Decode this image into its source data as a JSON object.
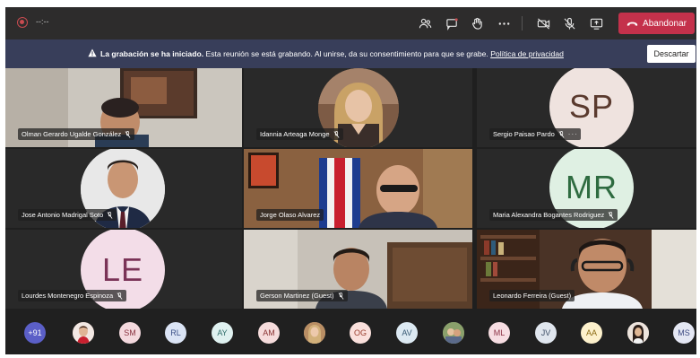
{
  "topbar": {
    "timer": "--:--",
    "icons": [
      "people-icon",
      "chat-icon",
      "raise-hand-icon",
      "more-icon",
      "camera-off-icon",
      "mic-off-icon",
      "share-icon"
    ],
    "leave_label": "Abandonar",
    "leave_color": "#c4314b"
  },
  "banner": {
    "title": "La grabación se ha iniciado.",
    "message": "Esta reunión se está grabando. Al unirse, da su consentimiento para que se grabe.",
    "link": "Política de privacidad",
    "dismiss_label": "Descartar",
    "color": "#383e5a"
  },
  "tiles": [
    {
      "name": "Olman Gerardo Ugalde González",
      "type": "video"
    },
    {
      "name": "Idannia Arteaga Monge",
      "type": "photo"
    },
    {
      "name": "Sergio Paisao Pardo",
      "type": "initials",
      "initials": "SP",
      "bg": "#efe3df",
      "fg": "#5a3a2e",
      "more": "···"
    },
    {
      "name": "Jose Antonio Madrigal Soto",
      "type": "photo"
    },
    {
      "name": "Jorge Olaso Alvarez",
      "type": "video"
    },
    {
      "name": "Maria Alexandra Bogantes Rodriguez",
      "type": "initials",
      "initials": "MR",
      "bg": "#dff0e3",
      "fg": "#2e6b40"
    },
    {
      "name": "Lourdes Montenegro Espinoza",
      "type": "initials",
      "initials": "LE",
      "bg": "#f3dde8",
      "fg": "#7a3357"
    },
    {
      "name": "Gerson Martinez (Guest)",
      "type": "video"
    },
    {
      "name": "Leonardo Ferreira (Guest)",
      "type": "video"
    }
  ],
  "roster": [
    {
      "label": "+91",
      "bg": "#5b5fc7",
      "fg": "#ffffff"
    },
    {
      "label": "",
      "photo": true,
      "bg": "#c98e7a"
    },
    {
      "label": "SM",
      "bg": "#f4d9de",
      "fg": "#8a3340"
    },
    {
      "label": "RL",
      "bg": "#dbe4f5",
      "fg": "#3a4f86"
    },
    {
      "label": "AY",
      "bg": "#dff1f0",
      "fg": "#2f6d6a"
    },
    {
      "label": "AM",
      "bg": "#f6dcdc",
      "fg": "#8a3434"
    },
    {
      "label": "",
      "photo": true,
      "bg": "#d7b08c"
    },
    {
      "label": "OG",
      "bg": "#fae0dc",
      "fg": "#9a3f2f"
    },
    {
      "label": "AV",
      "bg": "#dce9f2",
      "fg": "#385a75"
    },
    {
      "label": "",
      "photo": true,
      "bg": "#9fae83"
    },
    {
      "label": "ML",
      "bg": "#f7dde2",
      "fg": "#8d3346"
    },
    {
      "label": "JV",
      "bg": "#e0e6ee",
      "fg": "#3e4f66"
    },
    {
      "label": "AA",
      "bg": "#fdf1cc",
      "fg": "#8a6a12"
    },
    {
      "label": "",
      "photo": true,
      "bg": "#e7d7ce"
    },
    {
      "label": "MS",
      "bg": "#e4e7f3",
      "fg": "#3d4a82"
    }
  ]
}
